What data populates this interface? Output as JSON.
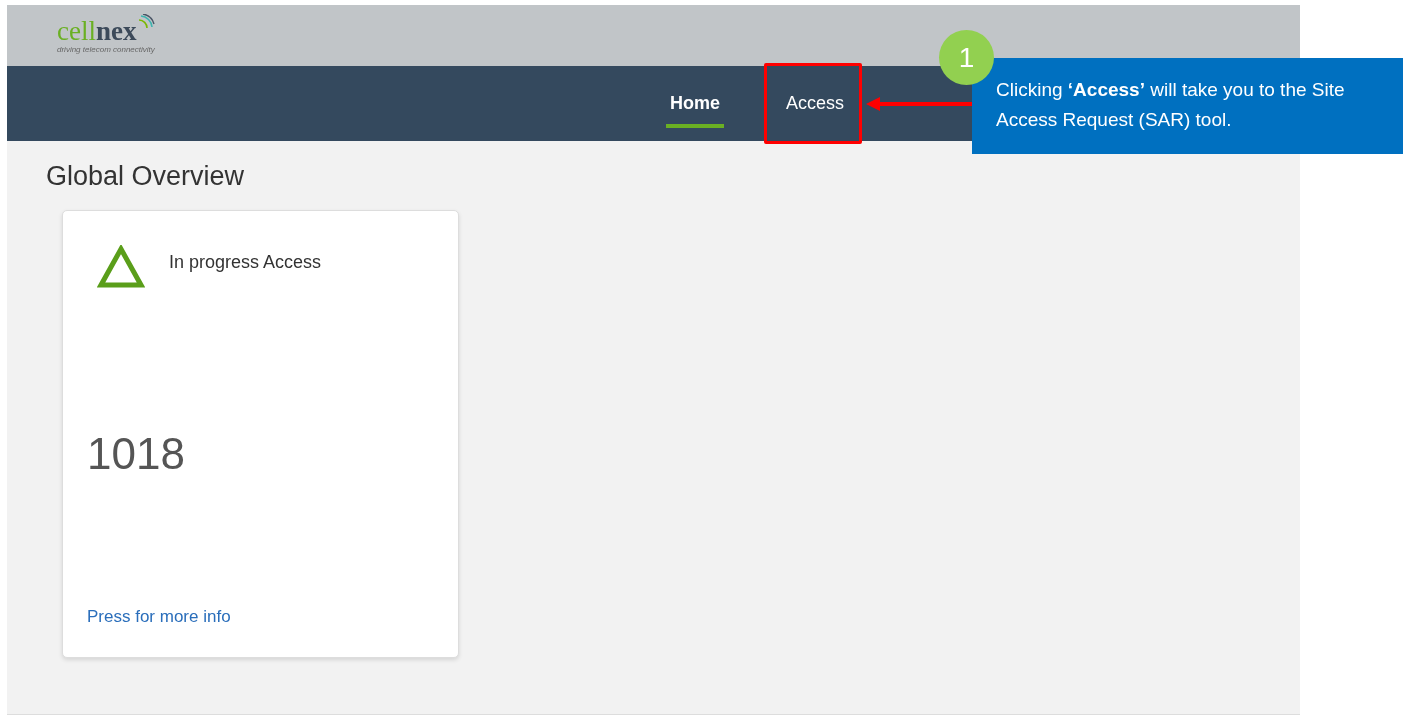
{
  "header": {
    "logo_parts": [
      "cell",
      "nex"
    ],
    "tagline": "driving telecom connectivity"
  },
  "nav": [
    {
      "label": "Home",
      "selected": true
    },
    {
      "label": "Access",
      "selected": false
    }
  ],
  "page_title": "Global Overview",
  "cards": [
    {
      "title": "In progress Access",
      "count": "1018",
      "link": "Press for more info"
    }
  ],
  "annotation": {
    "number": "1",
    "text": "Clicking **‘Access’** will take you to the Site Access Request (SAR) tool."
  }
}
